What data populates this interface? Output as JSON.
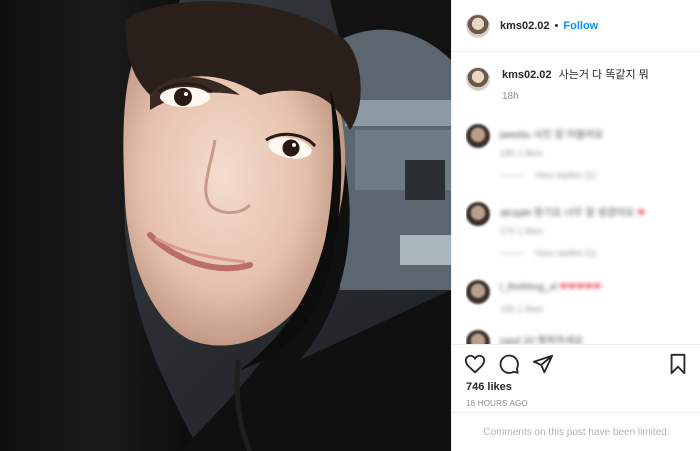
{
  "post": {
    "username": "kms02.02",
    "follow_label": "Follow",
    "separator": "•",
    "caption": "사는거 다 똑같지 뭐",
    "caption_time": "18h",
    "likes": "746 likes",
    "time_ago": "18 HOURS AGO",
    "limited_notice": "Comments on this post have been limited."
  },
  "comments": [
    {
      "text": "jweeliu 사진 잘 어울려요",
      "meta": "18h   1 likes",
      "replies": "View replies (1)"
    },
    {
      "text": "alcspkt 항기요 너무 잘 생겼어요",
      "meta": "17h   1 likes",
      "replies": "View replies (1)"
    },
    {
      "text": "l_thnhhng_xl",
      "meta": "16h   1 likes",
      "replies": ""
    },
    {
      "text": "jupyl 20 행복하세요",
      "meta": "",
      "replies": ""
    }
  ],
  "colors": {
    "follow_blue": "#0095f6",
    "heart_red": "#ed4956",
    "muted_text": "#8e8e8e"
  },
  "icons": [
    "heart-icon",
    "comment-icon",
    "share-icon",
    "bookmark-icon"
  ]
}
